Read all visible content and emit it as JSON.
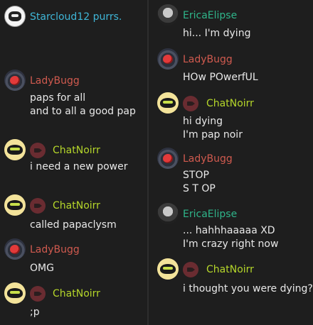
{
  "left": {
    "status": {
      "text": "Starcloud12 purrs."
    },
    "messages": [
      {
        "author": "LadyBugg",
        "text": "paps for all\nand to all a good pap"
      },
      {
        "author": "ChatNoirr",
        "text": "i need a new power"
      },
      {
        "author": "ChatNoirr",
        "text": "called papaclysm"
      },
      {
        "author": "LadyBugg",
        "text": "OMG"
      },
      {
        "author": "ChatNoirr",
        "text": ";p"
      }
    ]
  },
  "right": {
    "messages": [
      {
        "author": "EricaElipse",
        "text": "hi... I'm dying"
      },
      {
        "author": "LadyBugg",
        "text": "HOw POwerfUL"
      },
      {
        "author": "ChatNoirr",
        "text": "hi dying\nI'm pap noir"
      },
      {
        "author": "LadyBugg",
        "text": "STOP\nS T OP"
      },
      {
        "author": "EricaElipse",
        "text": "... hahhhaaaaa XD\nI'm crazy right now"
      },
      {
        "author": "ChatNoirr",
        "text": "i thought you were dying?"
      }
    ]
  },
  "colors": {
    "LadyBugg": "#d05a4f",
    "ChatNoirr": "#b5d62a",
    "EricaElipse": "#2fb58a",
    "status": "#3fb6d7",
    "background": "#1e1e1e"
  }
}
